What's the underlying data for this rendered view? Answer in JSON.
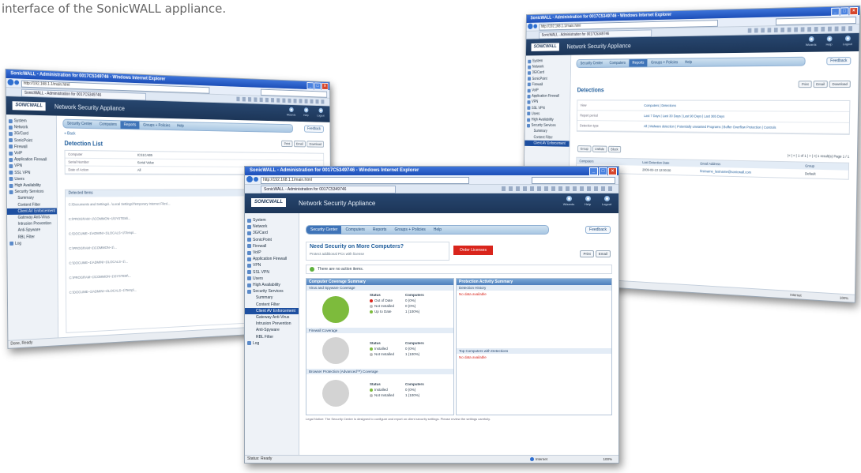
{
  "caption": "interface of the SonicWALL appliance.",
  "colors": {
    "ie_title": "#1d4fb8",
    "header": "#1c3557",
    "menu_active": "#3f74b8",
    "pie_green": "#7dbb3c",
    "pie_gray": "#d0d0d0",
    "red_button": "#d9251c"
  },
  "browser": {
    "title": "SonicWALL - Administration for 0017C5349746 - Windows Internet Explorer",
    "url": "http://192.168.1.1/main.html",
    "tab": "SonicWALL - Administration for 0017C5349746",
    "status_left": "Status: Ready",
    "status_zone": "Internet",
    "zoom": "100%"
  },
  "app": {
    "brand": "SONICWALL",
    "title": "Network Security Appliance",
    "header_icons": [
      {
        "label": "Wizards",
        "icon": "wizard-icon"
      },
      {
        "label": "Help",
        "icon": "help-icon"
      },
      {
        "label": "Logout",
        "icon": "logout-icon"
      }
    ],
    "feedback": "Feedback",
    "menu": [
      "Security Center",
      "Computers",
      "Reports",
      "Groups + Policies",
      "Help"
    ],
    "nav": [
      "System",
      "Network",
      "3G/Card",
      "SonicPoint",
      "Firewall",
      "VoIP",
      "Application Firewall",
      "VPN",
      "SSL VPN",
      "Users",
      "High Availability",
      "Security Services"
    ],
    "nav_sub": [
      "Summary",
      "Content Filter",
      "Client AV Enforcement",
      "Gateway Anti-Virus",
      "Intrusion Prevention",
      "Anti-Spyware",
      "RBL Filter"
    ],
    "nav_last": "Log",
    "buttons": {
      "print": "Print",
      "email": "Email",
      "download": "Download"
    }
  },
  "window_left": {
    "page_title": "Detection List",
    "back": "« Back",
    "fields": [
      {
        "k": "Computer",
        "v": "ICS1CAB5"
      },
      {
        "k": "Serial Number",
        "v": "Serial Value"
      },
      {
        "k": "Date of Action",
        "v": "All"
      }
    ],
    "list_header": "Detected Items",
    "list_lines": [
      "C:\\Documents and Settings\\...\\Local Settings\\Temporary Internet Files\\...",
      "C:\\PROGRAM~1\\COMMON~1\\SYSTEM\\...",
      "C:\\DOCUME~1\\ADMINI~1\\LOCALS~1\\Temp\\...",
      "C:\\PROGRAM~1\\COMMON~1\\...",
      "C:\\DOCUME~1\\ADMINI~1\\LOCALS~1\\...",
      "C:\\PROGRAM~1\\COMMON~1\\SYSTEM\\...",
      "C:\\DOCUME~1\\ADMINI~1\\LOCALS~1\\Temp\\..."
    ],
    "status": "Done, Ready"
  },
  "window_right": {
    "page_title": "Detections",
    "filters": [
      {
        "k": "View",
        "v": "Computers | Detections"
      },
      {
        "k": "Report period",
        "v": "Last 7 Days | Last 30 Days | Last 90 Days | Last 365 Days"
      },
      {
        "k": "Detection type",
        "v": "All | Malware detection | Potentially unwanted Programs | Buffer Overflow Protection | Controls"
      }
    ],
    "actions": [
      "Group",
      "Unhide",
      "Block"
    ],
    "pager": "|< | < | 1 of 1 | > | >| 1 result(s) Page 1 / 1",
    "columns": [
      "Computers",
      "Last Detection Date",
      "Email Address",
      "Group"
    ],
    "row": [
      "ICS1CAB5",
      "2009-03-13 12:00:00",
      "firstname_lastname@sonicwall.com",
      "Default"
    ]
  },
  "window_front": {
    "promo_title": "Need Security on More Computers?",
    "promo_sub": "Protect additional PCs with license",
    "promo_button": "Order Licenses",
    "info": "There are no action items.",
    "panel_left_title": "Computer Coverage Summary",
    "panel_right_title": "Protection Activity Summary",
    "sections": [
      {
        "title": "Virus and Spyware Coverage",
        "status_header": "Status",
        "computers_header": "Computers",
        "items": [
          {
            "label": "Out of Date",
            "value": "0 (0%)",
            "color": "#d9251c"
          },
          {
            "label": "Not Installed",
            "value": "0 (0%)",
            "color": "#bdbdbd"
          },
          {
            "label": "Up to Date",
            "value": "1 (100%)",
            "color": "#7dbb3c"
          }
        ],
        "pie": "green"
      },
      {
        "title": "Firewall Coverage",
        "status_header": "Status",
        "computers_header": "Computers",
        "items": [
          {
            "label": "Installed",
            "value": "0 (0%)",
            "color": "#7dbb3c"
          },
          {
            "label": "Not Installed",
            "value": "1 (100%)",
            "color": "#bdbdbd"
          }
        ],
        "pie": "gray"
      },
      {
        "title": "Browser Protection (Advanced™) Coverage",
        "status_header": "Status",
        "computers_header": "Computers",
        "items": [
          {
            "label": "Installed",
            "value": "0 (0%)",
            "color": "#7dbb3c"
          },
          {
            "label": "Not Installed",
            "value": "1 (100%)",
            "color": "#bdbdbd"
          }
        ],
        "pie": "gray"
      }
    ],
    "right_sections": [
      {
        "title": "Detection History",
        "text": "No data available"
      },
      {
        "title": "Top Computers with Detections",
        "text": "No data available"
      }
    ],
    "footer_note": "Legal Notice: The Security Center is designed to configure and report on client security settings. Please review the settings carefully."
  }
}
